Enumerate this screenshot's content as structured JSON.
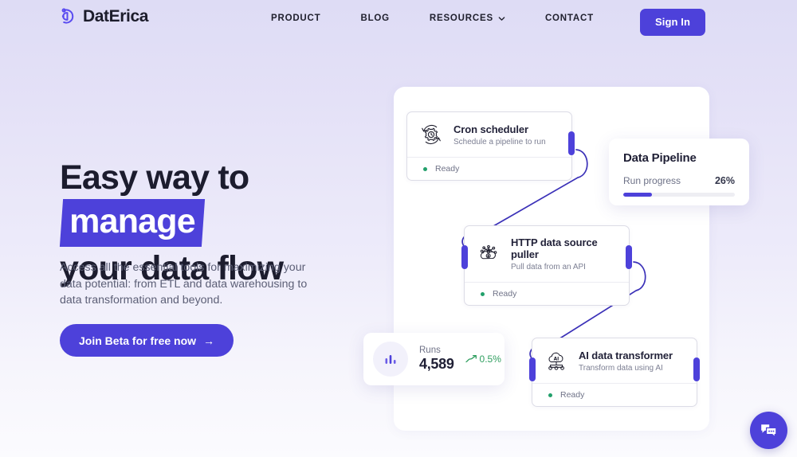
{
  "brand": {
    "name": "DatErica",
    "logo_icon": "daterica-circular-d-logo"
  },
  "nav": {
    "items": [
      {
        "label": "PRODUCT",
        "has_dropdown": false
      },
      {
        "label": "BLOG",
        "has_dropdown": false
      },
      {
        "label": "RESOURCES",
        "has_dropdown": true,
        "dropdown_icon": "chevron-down-icon"
      },
      {
        "label": "CONTACT",
        "has_dropdown": false
      }
    ],
    "signin_label": "Sign In"
  },
  "hero": {
    "headline_part1": "Easy way to",
    "headline_highlight": "manage",
    "headline_part2": "your data flow",
    "subtext": "Access all the essential tools for maximizing your data potential: from ETL and data warehousing to data transformation and beyond.",
    "cta_label": "Join Beta for free now",
    "cta_arrow": "→"
  },
  "pipeline": {
    "nodes": [
      {
        "title": "Cron scheduler",
        "desc": "Schedule a pipeline to run",
        "status": "Ready",
        "icon": "gear-clock-icon"
      },
      {
        "title": "HTTP data source puller",
        "desc": "Pull data from an API",
        "status": "Ready",
        "icon": "cloud-network-download-icon"
      },
      {
        "title": "AI data transformer",
        "desc": "Transform data using AI",
        "status": "Ready",
        "icon": "ai-cloud-node-icon"
      }
    ]
  },
  "data_pipeline_card": {
    "title": "Data Pipeline",
    "progress_label": "Run progress",
    "progress_value": "26%",
    "progress_percent": 26
  },
  "runs_card": {
    "label": "Runs",
    "value": "4,589",
    "delta": "0.5%",
    "delta_direction": "up",
    "icon": "bar-chart-icon",
    "trend_icon": "trend-up-arrow-icon"
  },
  "chat_widget": {
    "icon": "chat-bubbles-icon"
  },
  "colors": {
    "accent": "#4d41da",
    "headline": "#1c1c2e",
    "body_text": "#5c5f76",
    "status_green": "#22a06b",
    "delta_green": "#2f9e5f",
    "bg_top": "#dedcf5",
    "bg_bottom": "#fbfbfe",
    "card_border": "#dcdce6"
  }
}
